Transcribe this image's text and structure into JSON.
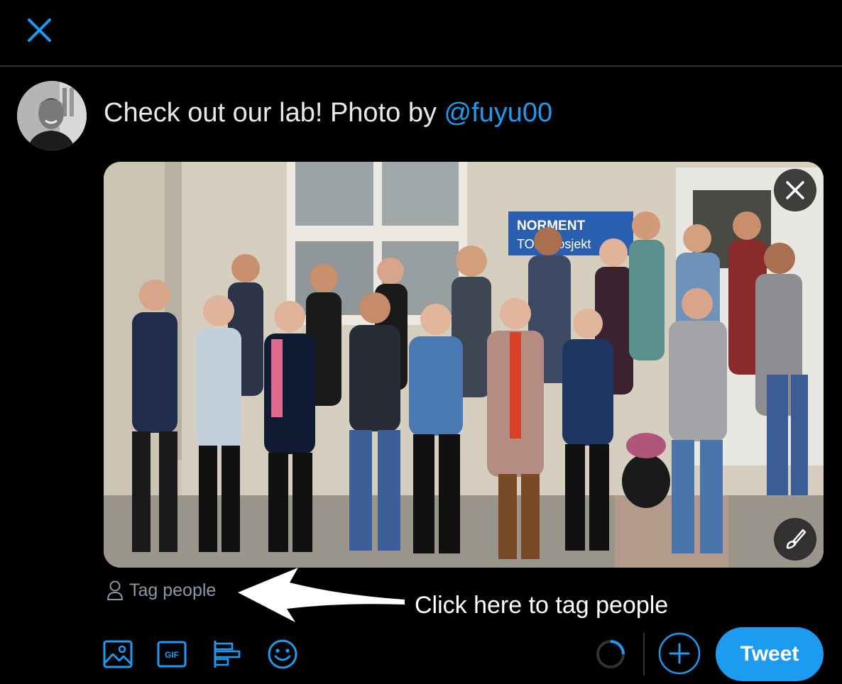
{
  "compose": {
    "text_prefix": "Check out our lab! Photo by ",
    "mention": "@fuyu00"
  },
  "media": {
    "sign_line1": "NORMENT",
    "sign_line2": "TOP prosjekt"
  },
  "tag_people": {
    "label": "Tag people"
  },
  "annotation": {
    "text": "Click here to tag people"
  },
  "toolbar": {
    "tweet_label": "Tweet",
    "icons": [
      "image-icon",
      "gif-icon",
      "poll-icon",
      "emoji-icon"
    ]
  },
  "colors": {
    "accent": "#1d9bf0",
    "background": "#000000",
    "muted": "#8b98a5"
  }
}
